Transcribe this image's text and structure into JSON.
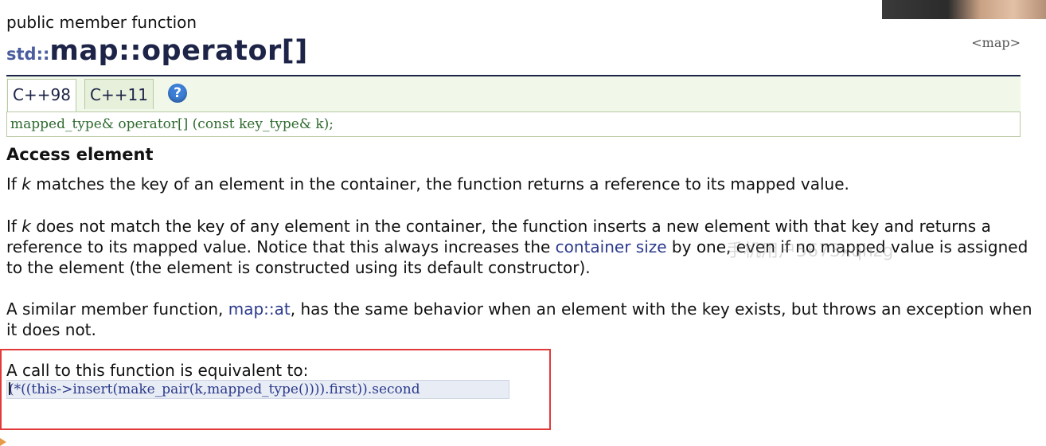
{
  "page": {
    "kind": "public member function",
    "namespace": "std::",
    "function_name": "map::operator[]",
    "header_link": "<map>"
  },
  "tabs": [
    {
      "label": "C++98",
      "active": true
    },
    {
      "label": "C++11",
      "active": false
    }
  ],
  "help_icon": {
    "name": "help-icon",
    "glyph": "?",
    "color": "#3c7fd6"
  },
  "declaration": "mapped_type& operator[] (const key_type& k);",
  "section_title": "Access element",
  "paragraphs": {
    "p1": {
      "pre": "If ",
      "k": "k",
      "post": " matches the key of an element in the container, the function returns a reference to its mapped value."
    },
    "p2": {
      "pre": "If ",
      "k": "k",
      "mid": " does not match the key of any element in the container, the function inserts a new element with that key and returns a reference to its mapped value. Notice that this always increases the ",
      "link": "container size",
      "post": " by one, even if no mapped value is assigned to the element (the element is constructed using its default constructor)."
    },
    "p3": {
      "pre": "A similar member function, ",
      "link": "map::at",
      "post": ", has the same behavior when an element with the key exists, but throws an exception when it does not."
    }
  },
  "equivalent": {
    "label": "A call to this function is equivalent to:",
    "code": "(*((this->insert(make_pair(k,mapped_type()))).first)).second"
  },
  "watermark": "手机用户5673xqhzg",
  "colors": {
    "title": "#1d2447",
    "link": "#2b3a8c",
    "code": "#2f6a2f",
    "highlight_border": "#e23a3a",
    "tab_bg": "#f1f8ea"
  }
}
